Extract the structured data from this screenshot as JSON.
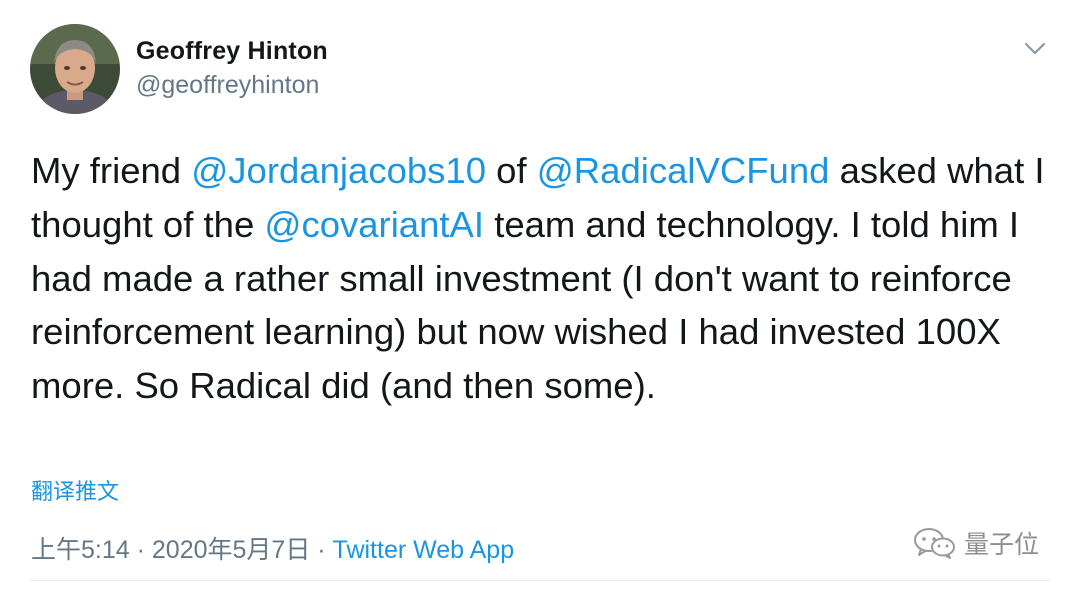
{
  "author": {
    "display_name": "Geoffrey Hinton",
    "handle": "@geoffreyhinton"
  },
  "tweet": {
    "seg1": "My friend ",
    "mention1": "@Jordanjacobs10",
    "seg2": " of ",
    "mention2": "@RadicalVCFund",
    "seg3": " asked what I thought of the ",
    "mention3": "@covariantAI",
    "seg4": " team and technology. I told him I had made a rather small investment (I don't want to reinforce reinforcement learning) but now wished I had invested 100X more. So Radical did (and then some)."
  },
  "translate_label": "翻译推文",
  "meta": {
    "time": "上午5:14",
    "separator1": " · ",
    "date": "2020年5月7日",
    "separator2": " · ",
    "source": "Twitter Web App"
  },
  "watermark": {
    "text": "量子位"
  },
  "colors": {
    "link": "#1b95e0",
    "text": "#14171a",
    "muted": "#657786"
  },
  "icons": {
    "caret": "chevron-down-icon",
    "watermark": "wechat-icon"
  }
}
